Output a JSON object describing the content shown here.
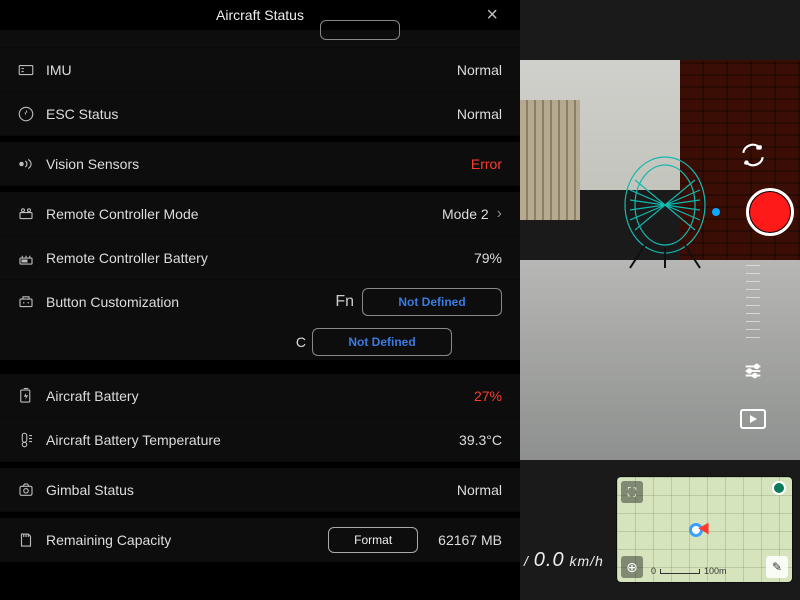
{
  "header": {
    "title": "Aircraft Status"
  },
  "rows": {
    "imu": {
      "label": "IMU",
      "value": "Normal"
    },
    "esc": {
      "label": "ESC Status",
      "value": "Normal"
    },
    "vision": {
      "label": "Vision Sensors",
      "value": "Error"
    },
    "rcmode": {
      "label": "Remote Controller Mode",
      "value": "Mode 2"
    },
    "rcbatt": {
      "label": "Remote Controller Battery",
      "value": "79%"
    },
    "btncust": {
      "label": "Button Customization"
    },
    "fn": {
      "key": "Fn",
      "value": "Not Defined"
    },
    "c": {
      "key": "C",
      "value": "Not Defined"
    },
    "acbatt": {
      "label": "Aircraft Battery",
      "value": "27%"
    },
    "actemp": {
      "label": "Aircraft Battery Temperature",
      "value": "39.3°C"
    },
    "gimbal": {
      "label": "Gimbal Status",
      "value": "Normal"
    },
    "remain": {
      "label": "Remaining Capacity",
      "value": "62167 MB",
      "button": "Format"
    }
  },
  "telemetry": {
    "speed_value": "0.0",
    "speed_unit": "km/h",
    "prefix": "/"
  },
  "map": {
    "scale_zero": "0",
    "scale_label": "100m"
  }
}
